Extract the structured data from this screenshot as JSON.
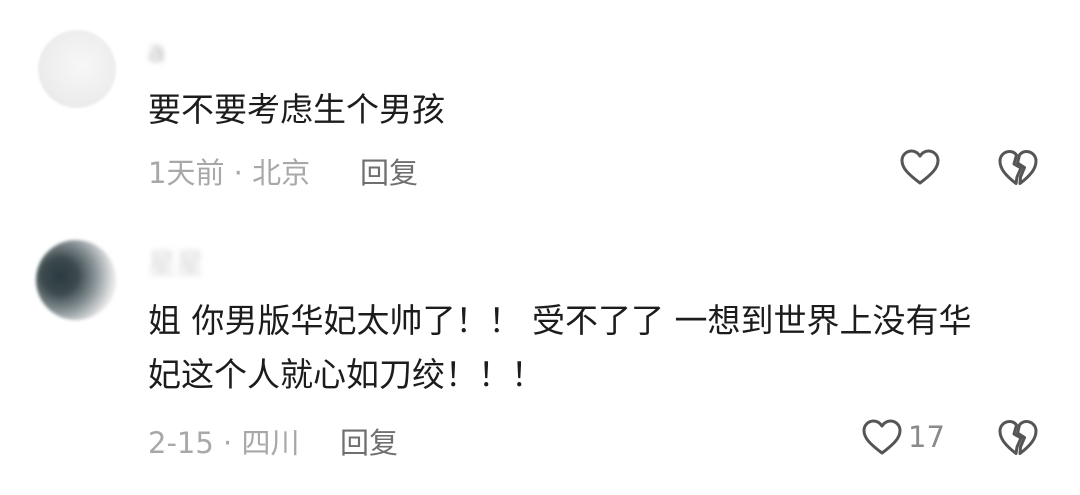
{
  "comments": [
    {
      "username": "a",
      "text_lines": [
        "要不要考虑生个男孩"
      ],
      "meta": "1天前 · 北京",
      "reply_label": "回复",
      "like_count": "",
      "icons": {
        "like": "heart-outline-icon",
        "dislike": "broken-heart-icon"
      }
    },
    {
      "username": "星星",
      "text_lines": [
        "姐 你男版华妃太帅了！！ 受不了了 一想到世界上没有华",
        "妃这个人就心如刀绞！！！"
      ],
      "meta": "2-15 · 四川",
      "reply_label": "回复",
      "like_count": "17",
      "icons": {
        "like": "heart-outline-icon",
        "dislike": "broken-heart-icon"
      }
    }
  ],
  "colors": {
    "text": "#1c1c1c",
    "meta": "#a8a8a8",
    "reply": "#6f6f6f",
    "icon": "#555555"
  }
}
